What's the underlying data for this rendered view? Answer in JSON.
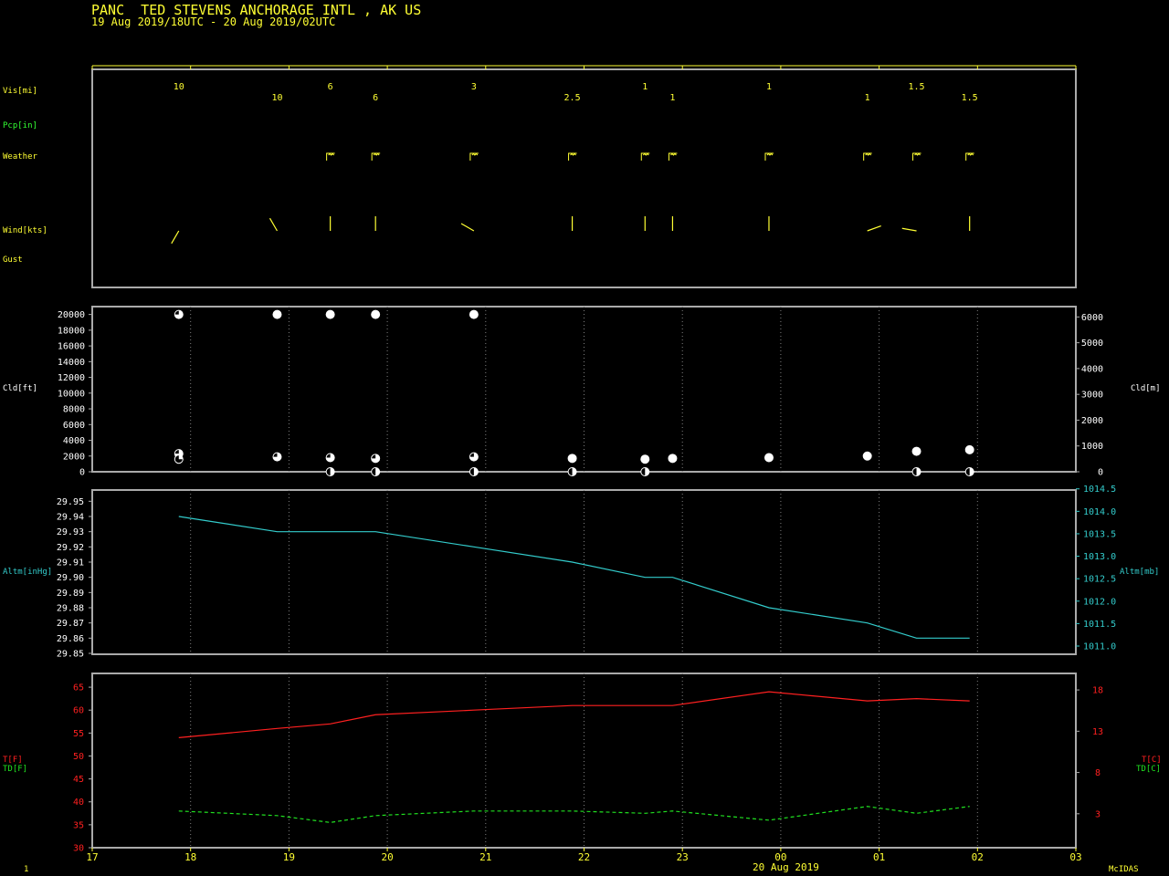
{
  "header": {
    "title": "PANC  TED STEVENS ANCHORAGE INTL , AK US",
    "range": "19 Aug 2019/18UTC - 20 Aug 2019/02UTC"
  },
  "labels": {
    "vis": "Vis[mi]",
    "pcp": "Pcp[in]",
    "weather": "Weather",
    "wind": "Wind[kts]",
    "gust": "Gust",
    "cld_ft": "Cld[ft]",
    "cld_m": "Cld[m]",
    "altm_inhg": "Altm[inHg]",
    "altm_mb": "Altm[mb]",
    "t_f": "T[F]",
    "td_f": "TD[F]",
    "t_c": "T[C]",
    "td_c": "TD[C]",
    "date": "20 Aug 2019",
    "frame": "1",
    "brand": "McIDAS"
  },
  "colors": {
    "background": "#000000",
    "frame": "#aaaaaa",
    "grid": "#808080",
    "text": "#ffff33",
    "pcp_label": "#33ff33",
    "altimeter": "#33cccc",
    "temperature": "#ff2020",
    "dewpoint": "#20e020"
  },
  "chart_data": {
    "type": "line",
    "x_axis": {
      "range_hours": [
        17,
        27
      ],
      "tick_labels": [
        "17",
        "18",
        "19",
        "20",
        "21",
        "22",
        "23",
        "00",
        "01",
        "02",
        "03"
      ]
    },
    "visibility": {
      "upper": [
        {
          "t": 17.88,
          "label": "10"
        },
        {
          "t": 19.42,
          "label": "6"
        },
        {
          "t": 20.88,
          "label": "3"
        },
        {
          "t": 22.62,
          "label": "1"
        },
        {
          "t": 23.88,
          "label": "1"
        },
        {
          "t": 25.38,
          "label": "1.5"
        }
      ],
      "lower": [
        {
          "t": 18.88,
          "label": "10"
        },
        {
          "t": 19.88,
          "label": "6"
        },
        {
          "t": 21.88,
          "label": "2.5"
        },
        {
          "t": 22.9,
          "label": "1"
        },
        {
          "t": 24.88,
          "label": "1"
        },
        {
          "t": 25.92,
          "label": "1.5"
        }
      ]
    },
    "weather_times": [
      19.42,
      19.88,
      20.88,
      21.88,
      22.62,
      22.9,
      23.88,
      24.88,
      25.38,
      25.92
    ],
    "wind": [
      {
        "t": 17.88,
        "dir": 210
      },
      {
        "t": 18.88,
        "dir": 330
      },
      {
        "t": 19.42,
        "dir": 360
      },
      {
        "t": 19.88,
        "dir": 360
      },
      {
        "t": 20.88,
        "dir": 300
      },
      {
        "t": 21.88,
        "dir": 360
      },
      {
        "t": 22.62,
        "dir": 360
      },
      {
        "t": 22.9,
        "dir": 360
      },
      {
        "t": 23.88,
        "dir": 360
      },
      {
        "t": 24.88,
        "dir": 70
      },
      {
        "t": 25.38,
        "dir": 280
      },
      {
        "t": 25.92,
        "dir": 360
      }
    ],
    "clouds": {
      "ylim_ft": [
        0,
        21000
      ],
      "yticks_ft": [
        0,
        2000,
        4000,
        6000,
        8000,
        10000,
        12000,
        14000,
        16000,
        18000,
        20000
      ],
      "right_ticks_m": [
        0,
        1000,
        2000,
        3000,
        4000,
        5000,
        6000
      ],
      "layers": [
        {
          "t": 17.88,
          "ft": 20000,
          "cover": 0.75
        },
        {
          "t": 18.88,
          "ft": 20000,
          "cover": 1.0
        },
        {
          "t": 19.42,
          "ft": 20000,
          "cover": 1.0
        },
        {
          "t": 19.88,
          "ft": 20000,
          "cover": 1.0
        },
        {
          "t": 20.88,
          "ft": 20000,
          "cover": 1.0
        },
        {
          "t": 17.88,
          "ft": 2300,
          "cover": 0.75
        },
        {
          "t": 17.88,
          "ft": 1600,
          "cover": 0.25
        },
        {
          "t": 18.88,
          "ft": 1900,
          "cover": 0.75
        },
        {
          "t": 19.42,
          "ft": 1800,
          "cover": 0.75
        },
        {
          "t": 19.88,
          "ft": 1700,
          "cover": 0.75
        },
        {
          "t": 20.88,
          "ft": 1900,
          "cover": 0.75
        },
        {
          "t": 21.88,
          "ft": 1700,
          "cover": 1.0
        },
        {
          "t": 22.62,
          "ft": 1600,
          "cover": 1.0
        },
        {
          "t": 22.9,
          "ft": 1700,
          "cover": 1.0
        },
        {
          "t": 23.88,
          "ft": 1800,
          "cover": 1.0
        },
        {
          "t": 24.88,
          "ft": 2000,
          "cover": 1.0
        },
        {
          "t": 25.38,
          "ft": 2600,
          "cover": 1.0
        },
        {
          "t": 25.92,
          "ft": 2800,
          "cover": 1.0
        },
        {
          "t": 19.42,
          "ft": 0,
          "cover": 0.5
        },
        {
          "t": 19.88,
          "ft": 0,
          "cover": 0.5
        },
        {
          "t": 20.88,
          "ft": 0,
          "cover": 0.5
        },
        {
          "t": 21.88,
          "ft": 0,
          "cover": 0.5
        },
        {
          "t": 22.62,
          "ft": 0,
          "cover": 0.5
        },
        {
          "t": 25.38,
          "ft": 0,
          "cover": 0.5
        },
        {
          "t": 25.92,
          "ft": 0,
          "cover": 0.5
        }
      ]
    },
    "altimeter": {
      "ylim_inhg": [
        29.85,
        29.955
      ],
      "yticks_inhg": [
        "29.85",
        "29.86",
        "29.87",
        "29.88",
        "29.89",
        "29.90",
        "29.91",
        "29.92",
        "29.93",
        "29.94",
        "29.95"
      ],
      "right_ticks_mb": [
        "1011.0",
        "1011.5",
        "1012.0",
        "1012.5",
        "1013.0",
        "1013.5",
        "1014.0",
        "1014.5"
      ],
      "points": [
        {
          "t": 17.88,
          "inhg": 29.94
        },
        {
          "t": 18.88,
          "inhg": 29.93
        },
        {
          "t": 19.88,
          "inhg": 29.93
        },
        {
          "t": 20.88,
          "inhg": 29.92
        },
        {
          "t": 21.88,
          "inhg": 29.91
        },
        {
          "t": 22.62,
          "inhg": 29.9
        },
        {
          "t": 22.9,
          "inhg": 29.9
        },
        {
          "t": 23.88,
          "inhg": 29.88
        },
        {
          "t": 24.88,
          "inhg": 29.87
        },
        {
          "t": 25.38,
          "inhg": 29.86
        },
        {
          "t": 25.92,
          "inhg": 29.86
        }
      ]
    },
    "temperature": {
      "ylim_f": [
        30,
        68
      ],
      "yticks_f": [
        30,
        35,
        40,
        45,
        50,
        55,
        60,
        65
      ],
      "right_ticks_c": [
        3,
        8,
        13,
        18
      ],
      "series": [
        {
          "name": "T",
          "points": [
            {
              "t": 17.88,
              "f": 54
            },
            {
              "t": 18.88,
              "f": 56
            },
            {
              "t": 19.42,
              "f": 57
            },
            {
              "t": 19.88,
              "f": 59
            },
            {
              "t": 20.88,
              "f": 60
            },
            {
              "t": 21.88,
              "f": 61
            },
            {
              "t": 22.62,
              "f": 61
            },
            {
              "t": 22.9,
              "f": 61
            },
            {
              "t": 23.88,
              "f": 64
            },
            {
              "t": 24.88,
              "f": 62
            },
            {
              "t": 25.38,
              "f": 62.5
            },
            {
              "t": 25.92,
              "f": 62
            }
          ]
        },
        {
          "name": "TD",
          "points": [
            {
              "t": 17.88,
              "f": 38
            },
            {
              "t": 18.88,
              "f": 37
            },
            {
              "t": 19.42,
              "f": 35.5
            },
            {
              "t": 19.88,
              "f": 37
            },
            {
              "t": 20.88,
              "f": 38
            },
            {
              "t": 21.88,
              "f": 38
            },
            {
              "t": 22.62,
              "f": 37.5
            },
            {
              "t": 22.9,
              "f": 38
            },
            {
              "t": 23.88,
              "f": 36
            },
            {
              "t": 24.88,
              "f": 39
            },
            {
              "t": 25.38,
              "f": 37.5
            },
            {
              "t": 25.92,
              "f": 39
            }
          ]
        }
      ]
    }
  }
}
